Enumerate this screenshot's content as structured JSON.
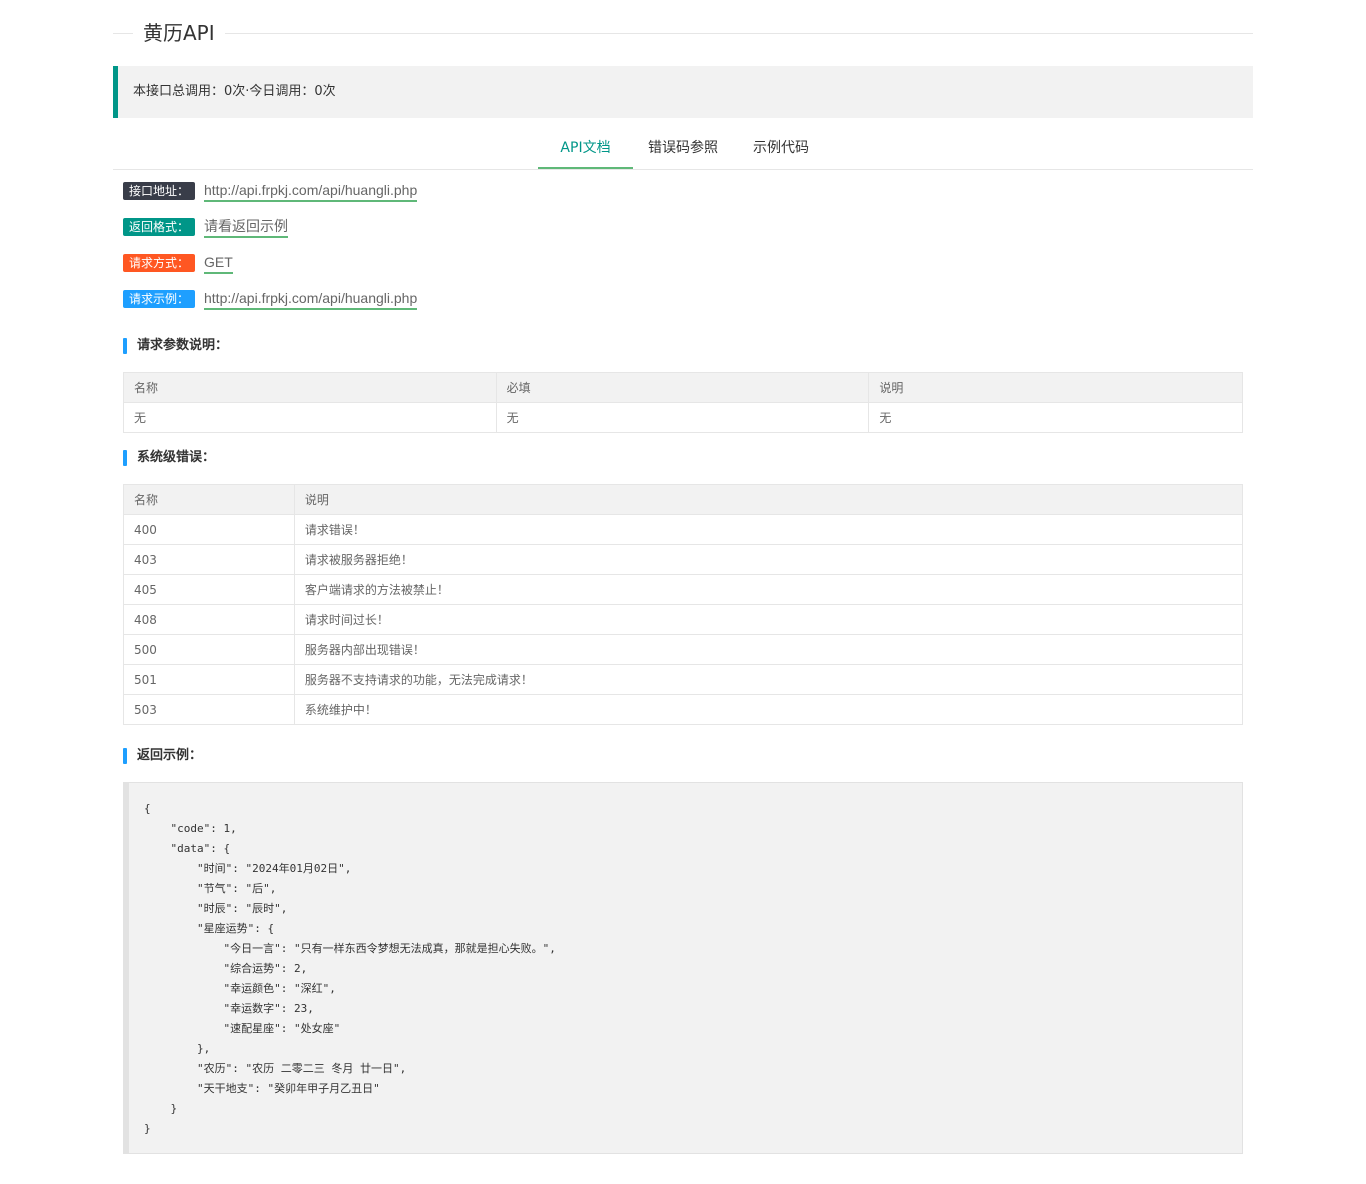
{
  "title": "黄历API",
  "stats": "本接口总调用：0次·今日调用：0次",
  "tabs": [
    {
      "label": "API文档",
      "active": true
    },
    {
      "label": "错误码参照",
      "active": false
    },
    {
      "label": "示例代码",
      "active": false
    }
  ],
  "info": [
    {
      "badge": "接口地址：",
      "value": "http://api.frpkj.com/api/huangli.php"
    },
    {
      "badge": "返回格式：",
      "value": "请看返回示例"
    },
    {
      "badge": "请求方式：",
      "value": "GET"
    },
    {
      "badge": "请求示例：",
      "value": "http://api.frpkj.com/api/huangli.php"
    }
  ],
  "sections": {
    "params": "请求参数说明：",
    "errors": "系统级错误：",
    "example": "返回示例："
  },
  "params_table": {
    "headers": [
      "名称",
      "必填",
      "说明"
    ],
    "rows": [
      [
        "无",
        "无",
        "无"
      ]
    ]
  },
  "errors_table": {
    "headers": [
      "名称",
      "说明"
    ],
    "rows": [
      [
        "400",
        "请求错误！"
      ],
      [
        "403",
        "请求被服务器拒绝！"
      ],
      [
        "405",
        "客户端请求的方法被禁止！"
      ],
      [
        "408",
        "请求时间过长！"
      ],
      [
        "500",
        "服务器内部出现错误！"
      ],
      [
        "501",
        "服务器不支持请求的功能，无法完成请求！"
      ],
      [
        "503",
        "系统维护中！"
      ]
    ]
  },
  "return_example": "{\n    \"code\": 1,\n    \"data\": {\n        \"时间\": \"2024年01月02日\",\n        \"节气\": \"后\",\n        \"时辰\": \"辰时\",\n        \"星座运势\": {\n            \"今日一言\": \"只有一样东西令梦想无法成真，那就是担心失败。\",\n            \"综合运势\": 2,\n            \"幸运颜色\": \"深红\",\n            \"幸运数字\": 23,\n            \"速配星座\": \"处女座\"\n        },\n        \"农历\": \"农历 二零二三 冬月 廿一日\",\n        \"天干地支\": \"癸卯年甲子月乙丑日\"\n    }\n}"
}
